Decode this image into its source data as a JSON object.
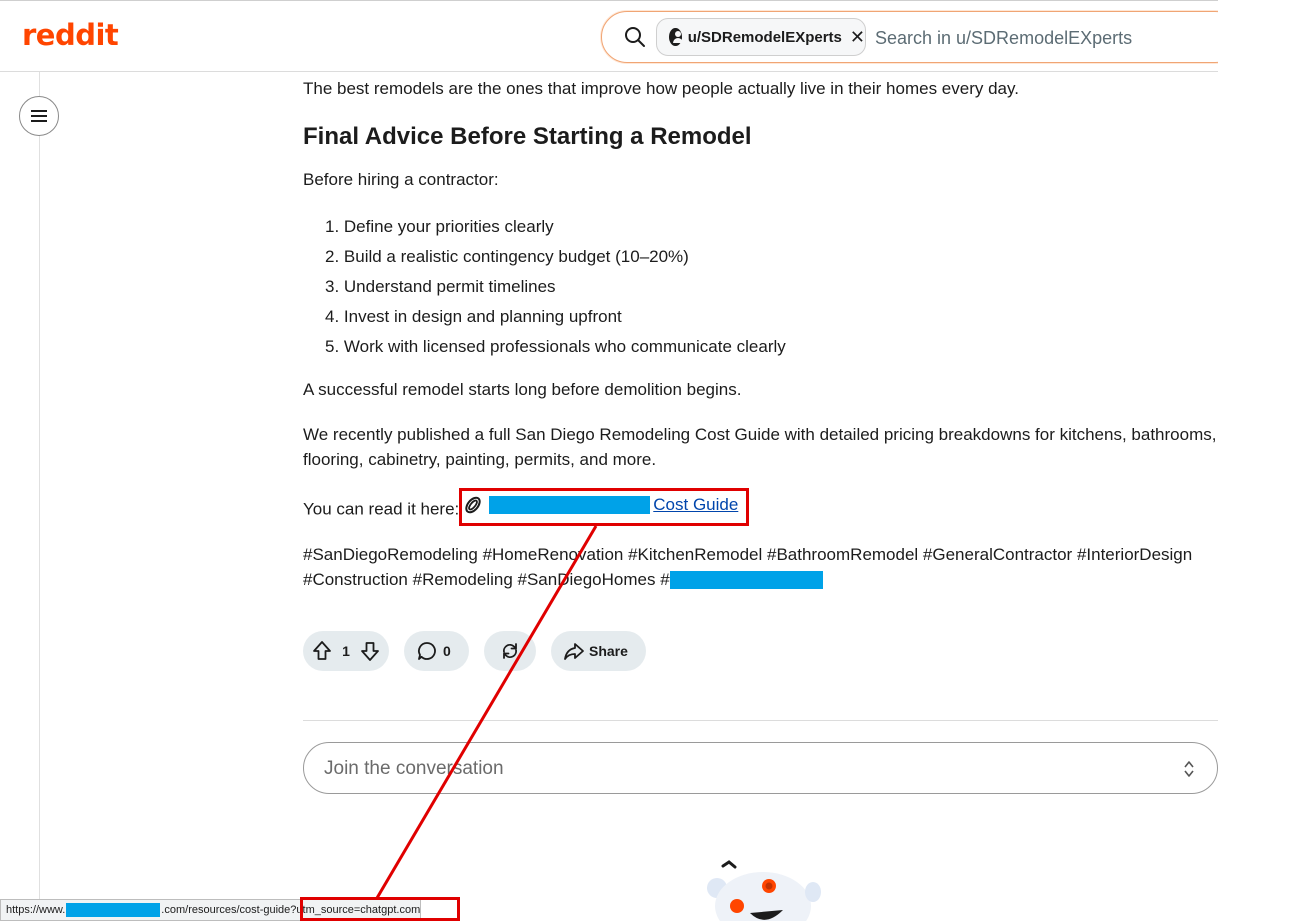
{
  "header": {
    "logo": "reddit",
    "search": {
      "chip_label": "u/SDRemodelEXperts",
      "placeholder": "Search in u/SDRemodelEXperts"
    }
  },
  "post": {
    "intro": "The best remodels are the ones that improve how people actually live in their homes every day.",
    "heading": "Final Advice Before Starting a Remodel",
    "before_hiring": "Before hiring a contractor:",
    "steps": [
      "1. Define your priorities clearly",
      "2. Build a realistic contingency budget (10–20%)",
      "3. Understand permit timelines",
      "4. Invest in design and planning upfront",
      "5. Work with licensed professionals who communicate clearly"
    ],
    "success": "A successful remodel starts long before demolition begins.",
    "published": "We recently published a full San Diego Remodeling Cost Guide with detailed pricing breakdowns for kitchens, bathrooms, flooring, cabinetry, painting, permits, and more.",
    "read_here": "You can read it here:",
    "link_text": "Cost Guide",
    "hashtags_line1": "#SanDiegoRemodeling #HomeRenovation #KitchenRemodel #BathroomRemodel #GeneralContractor #InteriorDesign",
    "hashtags_line2": "#Construction #Remodeling #SanDiegoHomes #"
  },
  "actions": {
    "vote_count": "1",
    "comment_count": "0",
    "share_label": "Share"
  },
  "comment": {
    "placeholder": "Join the conversation"
  },
  "statusbar": {
    "prefix": "https://www.",
    "middle": ".com/resources/cost-guide",
    "suffix": "?utm_source=chatgpt.com"
  },
  "colors": {
    "brand": "#ff4500",
    "redaction": "#00a2e8",
    "annotation": "#e00000",
    "link": "#0045ac"
  },
  "icons": [
    "search-icon",
    "user-icon",
    "close-icon",
    "menu-icon",
    "paperclip-icon",
    "upvote-icon",
    "downvote-icon",
    "comment-icon",
    "crosspost-icon",
    "share-icon",
    "resize-icon",
    "snoo-mascot"
  ]
}
